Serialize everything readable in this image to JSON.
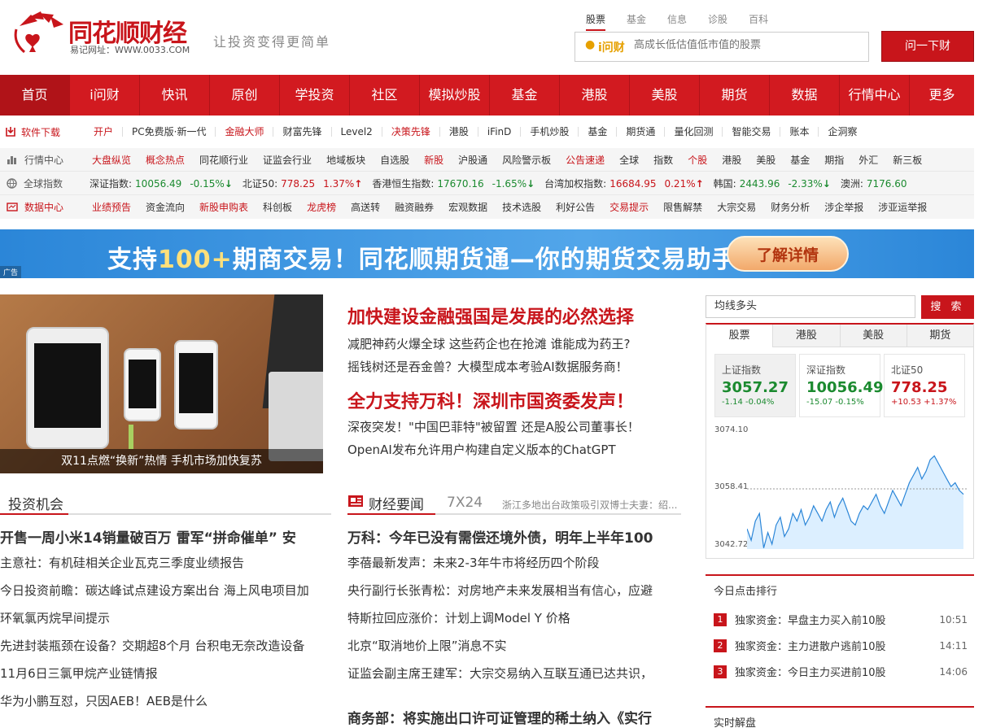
{
  "header": {
    "logo_text": "同花顺财经",
    "logo_url_text": "易记网址：WWW.0033.COM",
    "slogan": "让投资变得更简单",
    "search_tabs": [
      "股票",
      "基金",
      "信息",
      "诊股",
      "百科"
    ],
    "search_brand": "i问财",
    "search_placeholder": "高成长低估值低市值的股票",
    "search_button": "问一下财"
  },
  "nav": [
    "首页",
    "i问财",
    "快讯",
    "原创",
    "学投资",
    "社区",
    "模拟炒股",
    "基金",
    "港股",
    "美股",
    "期货",
    "数据",
    "行情中心",
    "更多"
  ],
  "download_row": {
    "lead": "软件下载",
    "items": [
      {
        "t": "开户",
        "red": true
      },
      {
        "t": "PC免费版·新一代",
        "red": false
      },
      {
        "t": "金融大师",
        "red": true
      },
      {
        "t": "财富先锋",
        "red": false
      },
      {
        "t": "Level2",
        "red": false
      },
      {
        "t": "决策先锋",
        "red": true
      },
      {
        "t": "港股",
        "red": false
      },
      {
        "t": "iFinD",
        "red": false
      },
      {
        "t": "手机炒股",
        "red": false
      },
      {
        "t": "基金",
        "red": false
      },
      {
        "t": "期货通",
        "red": false
      },
      {
        "t": "量化回测",
        "red": false
      },
      {
        "t": "智能交易",
        "red": false
      },
      {
        "t": "账本",
        "red": false
      },
      {
        "t": "企洞察",
        "red": false
      }
    ]
  },
  "market_row": {
    "lead": "行情中心",
    "items": [
      {
        "t": "大盘纵览",
        "red": true
      },
      {
        "t": "概念热点",
        "red": true
      },
      {
        "t": "同花顺行业",
        "red": false
      },
      {
        "t": "证监会行业",
        "red": false
      },
      {
        "t": "地域板块",
        "red": false
      },
      {
        "t": "自选股",
        "red": false
      },
      {
        "t": "新股",
        "red": true
      },
      {
        "t": "沪股通",
        "red": false
      },
      {
        "t": "风险警示板",
        "red": false
      },
      {
        "t": "公告速递",
        "red": true
      },
      {
        "t": "全球",
        "red": false
      },
      {
        "t": "指数",
        "red": false
      },
      {
        "t": "个股",
        "red": true
      },
      {
        "t": "港股",
        "red": false
      },
      {
        "t": "美股",
        "red": false
      },
      {
        "t": "基金",
        "red": false
      },
      {
        "t": "期指",
        "red": false
      },
      {
        "t": "外汇",
        "red": false
      },
      {
        "t": "新三板",
        "red": false
      }
    ]
  },
  "global_row": {
    "lead": "全球指数",
    "items": [
      {
        "name": "深证指数:",
        "val": "10056.49",
        "pct": "-0.15%",
        "up": false
      },
      {
        "name": "北证50:",
        "val": "778.25",
        "pct": "1.37%",
        "up": true
      },
      {
        "name": "香港恒生指数:",
        "val": "17670.16",
        "pct": "-1.65%",
        "up": false
      },
      {
        "name": "台湾加权指数:",
        "val": "16684.95",
        "pct": "0.21%",
        "up": true
      },
      {
        "name": "韩国:",
        "val": "2443.96",
        "pct": "-2.33%",
        "up": false
      },
      {
        "name": "澳洲:",
        "val": "7176.60",
        "pct": "",
        "up": false
      }
    ]
  },
  "data_row": {
    "lead": "数据中心",
    "items": [
      {
        "t": "业绩预告",
        "red": true
      },
      {
        "t": "资金流向",
        "red": false
      },
      {
        "t": "新股申购表",
        "red": true
      },
      {
        "t": "科创板",
        "red": false
      },
      {
        "t": "龙虎榜",
        "red": true
      },
      {
        "t": "高送转",
        "red": false
      },
      {
        "t": "融资融券",
        "red": false
      },
      {
        "t": "宏观数据",
        "red": false
      },
      {
        "t": "技术选股",
        "red": false
      },
      {
        "t": "利好公告",
        "red": false
      },
      {
        "t": "交易提示",
        "red": true
      },
      {
        "t": "限售解禁",
        "red": false
      },
      {
        "t": "大宗交易",
        "red": false
      },
      {
        "t": "财务分析",
        "red": false
      },
      {
        "t": "涉企举报",
        "red": false
      },
      {
        "t": "涉亚运举报",
        "red": false
      }
    ]
  },
  "banner": {
    "text_a": "支持",
    "text_hl": "100+",
    "text_b": "期商交易！同花顺期货通—你的期货交易助手",
    "button": "了解详情",
    "ad": "广告"
  },
  "photo_caption": "双11点燃“换新”热情 手机市场加快复苏",
  "headlines": [
    {
      "t": "加快建设金融强国是发展的必然选择",
      "big": true
    },
    {
      "t": "减肥神药火爆全球 这些药企也在抢滩 谁能成为药王?",
      "big": false
    },
    {
      "t": "摇钱树还是吞金兽？大模型成本考验AI数据服务商！",
      "big": false
    },
    {
      "t": "全力支持万科！深圳市国资委发声！",
      "big": true
    },
    {
      "t": "深夜突发！\"中国巴菲特\"被留置 还是A股公司董事长！",
      "big": false
    },
    {
      "t": "OpenAI发布允许用户构建自定义版本的ChatGPT",
      "big": false
    }
  ],
  "invest": {
    "title": "投资机会",
    "items": [
      "开售一周小米14销量破百万 雷军“拼命催单” 安",
      "主意社：有机硅相关企业瓦克三季度业绩报告",
      "今日投资前瞻：碳达峰试点建设方案出台 海上风电项目加",
      "环氧氯丙烷早间提示",
      "先进封装瓶颈在设备？交期超8个月 台积电无奈改造设备",
      "11月6日三氯甲烷产业链情报",
      "华为小鹏互怼，只因AEB！AEB是什么"
    ]
  },
  "finance": {
    "title": "财经要闻",
    "tab2": "7X24",
    "ticker": "浙江多地出台政策吸引双博士夫妻：绍...",
    "items": [
      "万科：今年已没有需偿还境外债，明年上半年100",
      "李蓓最新发声：未来2-3年牛市将经历四个阶段",
      "央行副行长张青松：对房地产未来发展相当有信心，应避",
      "特斯拉回应涨价：计划上调Model Y 价格",
      "北京“取消地价上限”消息不实",
      "证监会副主席王建军：大宗交易纳入互联互通已达共识，",
      "商务部：将实施出口许可证管理的稀土纳入《实行"
    ]
  },
  "right": {
    "search_value": "均线多头",
    "search_button": "搜 索",
    "tabs": [
      "股票",
      "港股",
      "美股",
      "期货"
    ],
    "cards": [
      {
        "name": "上证指数",
        "val": "3057.27",
        "chg": "-1.14 -0.04%",
        "up": false
      },
      {
        "name": "深证指数",
        "val": "10056.49",
        "chg": "-15.07 -0.15%",
        "up": false
      },
      {
        "name": "北证50",
        "val": "778.25",
        "chg": "+10.53 +1.37%",
        "up": true
      }
    ],
    "chart_labels": [
      "3074.10",
      "3058.41",
      "3042.72"
    ],
    "hot_title": "今日点击排行",
    "hot": [
      {
        "n": "1",
        "t": "独家资金：早盘主力买入前10股",
        "time": "10:51"
      },
      {
        "n": "2",
        "t": "独家资金：主力进散户逃前10股",
        "time": "14:11"
      },
      {
        "n": "3",
        "t": "独家资金：今日主力买进前10股",
        "time": "14:06"
      }
    ],
    "live_title": "实时解盘"
  },
  "chart_data": {
    "type": "line",
    "title": "",
    "ylim": [
      3042.72,
      3074.1
    ],
    "reference": 3058.41,
    "y_ticks": [
      "3074.10",
      "3058.41",
      "3042.72"
    ],
    "series": [
      {
        "values": [
          3048,
          3045,
          3050,
          3052,
          3043,
          3047,
          3044,
          3049,
          3051,
          3046,
          3048,
          3052,
          3050,
          3053,
          3049,
          3051,
          3054,
          3052,
          3050,
          3053,
          3055,
          3051,
          3054,
          3056,
          3053,
          3050,
          3049,
          3052,
          3054,
          3053,
          3055,
          3057,
          3054,
          3052,
          3055,
          3058,
          3056,
          3054,
          3057,
          3060,
          3062,
          3064,
          3061,
          3063,
          3066,
          3067,
          3065,
          3063,
          3061,
          3059,
          3060,
          3058,
          3057
        ]
      }
    ]
  }
}
